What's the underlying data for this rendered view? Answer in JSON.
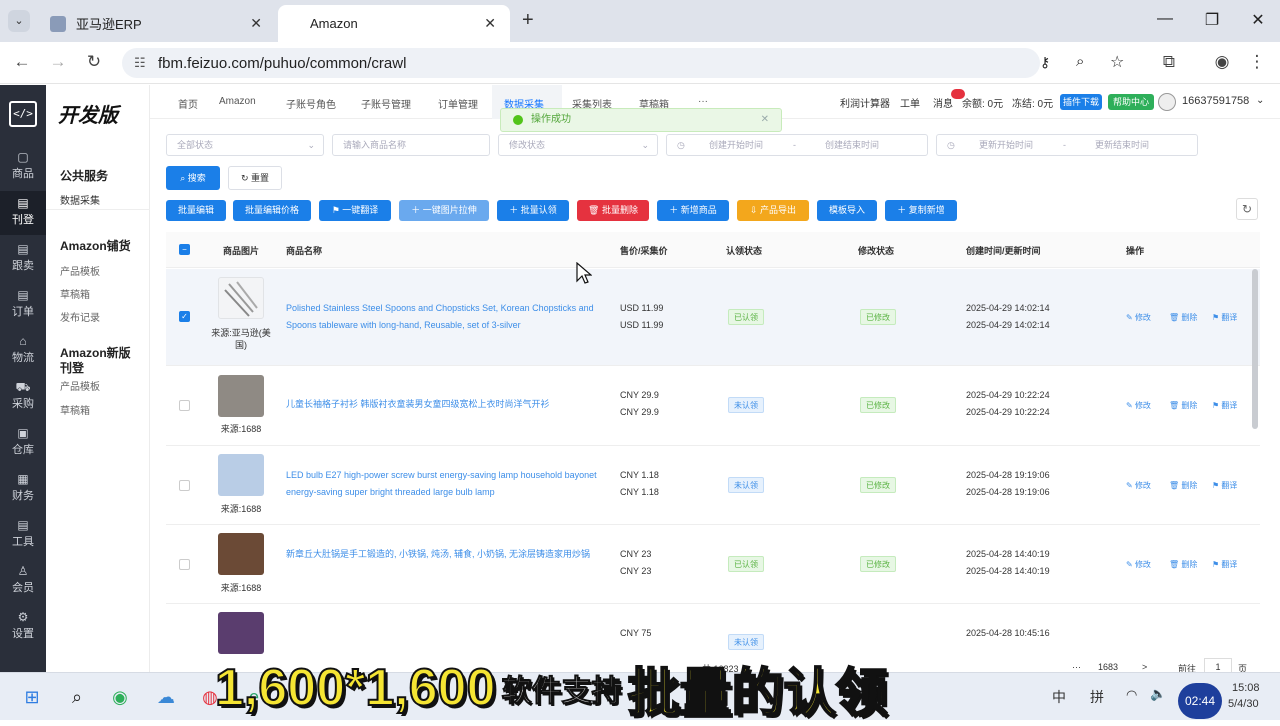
{
  "browser": {
    "tabs": [
      {
        "label": "亚马逊ERP",
        "active": false
      },
      {
        "label": "Amazon",
        "active": true
      }
    ],
    "new_tab": "+",
    "url": "fbm.feizuo.com/puhuo/common/crawl"
  },
  "sidebar": {
    "logo": "</>",
    "items": [
      {
        "label": "商品"
      },
      {
        "label": "刊登"
      },
      {
        "label": "跟卖"
      },
      {
        "label": "订单"
      },
      {
        "label": "物流"
      },
      {
        "label": "采购"
      },
      {
        "label": "仓库"
      },
      {
        "label": "财务"
      },
      {
        "label": "工具"
      },
      {
        "label": "会员"
      },
      {
        "label": "设置"
      }
    ]
  },
  "submenu": {
    "brand": "开发版",
    "groups": [
      {
        "title": "公共服务",
        "items": [
          "数据采集"
        ]
      },
      {
        "title": "Amazon铺货",
        "items": [
          "产品模板",
          "草稿箱",
          "发布记录"
        ]
      },
      {
        "title": "Amazon新版刊登",
        "items": [
          "产品模板",
          "草稿箱"
        ]
      }
    ]
  },
  "topnav": {
    "tabs": [
      "首页",
      "Amazon",
      "子账号角色",
      "子账号管理",
      "订单管理",
      "数据采集",
      "采集列表",
      "草稿箱",
      "···"
    ],
    "right": {
      "profit_calc": "利润计算器",
      "ticket": "工单",
      "message": "消息",
      "balance": "余额: 0元",
      "frozen": "冻结: 0元",
      "plugin_download": "插件下载",
      "help_center": "帮助中心",
      "phone": "16637591758"
    }
  },
  "toast": {
    "text": "操作成功"
  },
  "filters": {
    "status": "全部状态",
    "name_placeholder": "请输入商品名称",
    "modify_status": "修改状态",
    "create_start": "创建开始时间",
    "create_end": "创建结束时间",
    "update_start": "更新开始时间",
    "update_end": "更新结束时间",
    "dash": "-",
    "search": "搜索",
    "reset": "重置"
  },
  "actions": [
    "批量编辑",
    "批量编辑价格",
    "一键翻译",
    "一键图片拉伸",
    "批量认领",
    "批量删除",
    "新增商品",
    "产品导出",
    "模板导入",
    "复制新增"
  ],
  "table": {
    "columns": [
      "商品图片",
      "商品名称",
      "售价/采集价",
      "认领状态",
      "修改状态",
      "创建时间/更新时间",
      "操作"
    ],
    "ops": [
      "修改",
      "删除",
      "翻译"
    ],
    "rows": [
      {
        "source": "来源:亚马逊(美国)",
        "name": "Polished Stainless Steel Spoons and Chopsticks Set, Korean Chopsticks and Spoons tableware with long-hand, Reusable, set of 3-silver",
        "price1": "USD 11.99",
        "price2": "USD 11.99",
        "claim": "已认领",
        "modify": "已修改",
        "t1": "2025-04-29 14:02:14",
        "t2": "2025-04-29 14:02:14",
        "checked": true,
        "thumb": "#e9ecef"
      },
      {
        "source": "来源:1688",
        "name": "儿童长袖格子衬衫 韩版衬衣童装男女童四级宽松上衣时尚洋气开衫",
        "price1": "CNY 29.9",
        "price2": "CNY 29.9",
        "claim": "未认领",
        "modify": "已修改",
        "t1": "2025-04-29 10:22:24",
        "t2": "2025-04-29 10:22:24",
        "checked": false,
        "thumb": "#8f8a84"
      },
      {
        "source": "来源:1688",
        "name": "LED bulb E27 high-power screw burst energy-saving lamp household bayonet energy-saving super bright threaded large bulb lamp",
        "price1": "CNY 1.18",
        "price2": "CNY 1.18",
        "claim": "未认领",
        "modify": "已修改",
        "t1": "2025-04-28 19:19:06",
        "t2": "2025-04-28 19:19:06",
        "checked": false,
        "thumb": "#b9cde6"
      },
      {
        "source": "来源:1688",
        "name": "新章丘大肚锅是手工锻造的, 小铁锅, 炖汤, 辅食, 小奶锅, 无涂层铸造家用炒锅",
        "price1": "CNY 23",
        "price2": "CNY 23",
        "claim": "已认领",
        "modify": "已修改",
        "t1": "2025-04-28 14:40:19",
        "t2": "2025-04-28 14:40:19",
        "checked": false,
        "thumb": "#6b4a36"
      },
      {
        "source": "",
        "name": "",
        "price1": "CNY 75",
        "price2": "",
        "claim": "未认领",
        "modify": "",
        "t1": "2025-04-28 10:45:16",
        "t2": "",
        "checked": false,
        "thumb": "#5a3d6e"
      }
    ]
  },
  "pager": {
    "total": "共 16823",
    "ellipsis": "···",
    "last": "1683",
    "next": ">",
    "goto": "前往",
    "page": "1",
    "unit": "页"
  },
  "caption": {
    "part1": "1,600*1,600",
    "part2": "软件支持",
    "part3": "批量的认领"
  },
  "taskbar": {
    "ime1": "中",
    "ime2": "拼",
    "time": "15:08",
    "date": "5/4/30",
    "rec": "02:44"
  },
  "colors": {
    "primary": "#1b7fe8",
    "danger": "#e5323f",
    "warning": "#f3a71c",
    "success": "#52c41a",
    "sidebar": "#2a2f3a"
  }
}
